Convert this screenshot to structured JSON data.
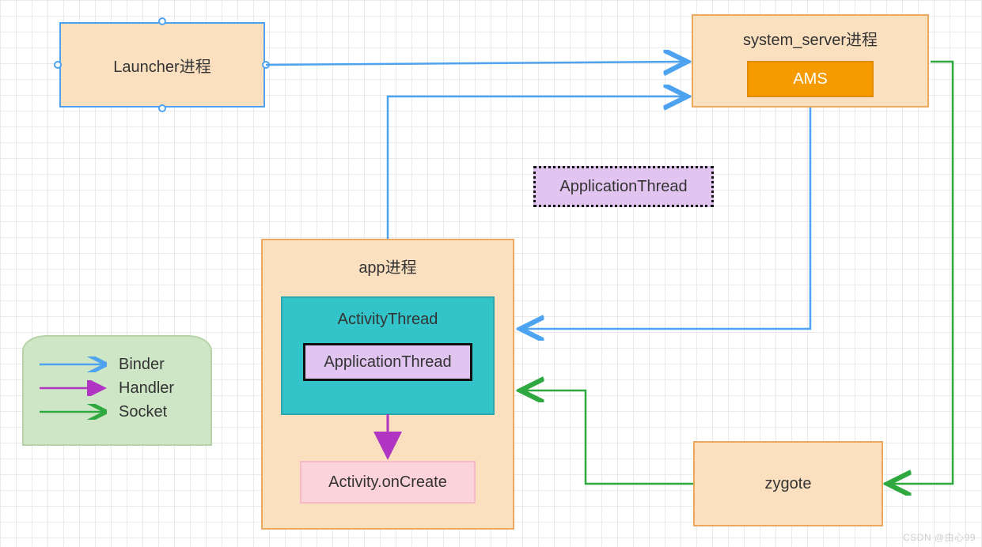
{
  "nodes": {
    "launcher": {
      "label": "Launcher进程"
    },
    "system_server": {
      "label": "system_server进程"
    },
    "ams": {
      "label": "AMS"
    },
    "app_thread_floating": {
      "label": "ApplicationThread"
    },
    "app_process": {
      "label": "app进程"
    },
    "activity_thread": {
      "label": "ActivityThread"
    },
    "app_thread_inner": {
      "label": "ApplicationThread"
    },
    "activity_oncreate": {
      "label": "Activity.onCreate"
    },
    "zygote": {
      "label": "zygote"
    }
  },
  "legend": {
    "binder": "Binder",
    "handler": "Handler",
    "socket": "Socket"
  },
  "colors": {
    "binder": "#4da3f0",
    "handler": "#b035c2",
    "socket": "#2fa93f",
    "peach_fill": "#fbe0c0",
    "peach_border": "#eba95d",
    "orange_fill": "#f59b00",
    "teal_fill": "#32c4c9",
    "lilac_fill": "#e1c4f0",
    "pink_fill": "#fcd2db",
    "legend_fill": "#cfe6c6"
  },
  "edges": [
    {
      "from": "launcher",
      "to": "system_server",
      "type": "binder"
    },
    {
      "from": "app_process",
      "to": "system_server",
      "type": "binder"
    },
    {
      "from": "system_server",
      "to": "app_process",
      "type": "binder"
    },
    {
      "from": "system_server",
      "to": "zygote",
      "type": "socket"
    },
    {
      "from": "zygote",
      "to": "app_process",
      "type": "socket"
    },
    {
      "from": "activity_thread",
      "to": "activity_oncreate",
      "type": "handler"
    }
  ],
  "watermark": "CSDN @由心99"
}
